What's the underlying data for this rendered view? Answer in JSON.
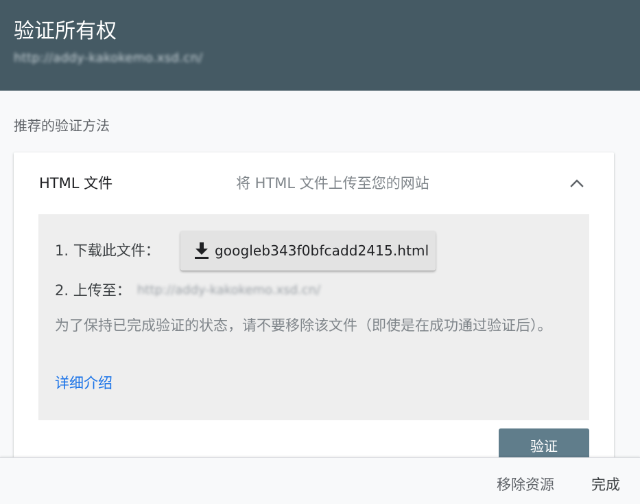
{
  "dialog": {
    "title": "验证所有权",
    "property_url": "http://addy-kakokemo.xsd.cn/"
  },
  "section": {
    "label": "推荐的验证方法"
  },
  "method_card": {
    "title": "HTML 文件",
    "subtitle": "将 HTML 文件上传至您的网站",
    "expanded": true,
    "step1_label": "1. 下载此文件：",
    "download_filename": "googleb343f0bfcadd2415.html",
    "step2_label": "2. 上传至：",
    "upload_url": "http://addy-kakokemo.xsd.cn/",
    "note": "为了保持已完成验证的状态，请不要移除该文件（即使是在成功通过验证后）。",
    "learn_more": "详细介绍",
    "verify_label": "验证"
  },
  "footer": {
    "remove_label": "移除资源",
    "done_label": "完成"
  },
  "colors": {
    "header_bg": "#455a64",
    "link": "#1a73e8",
    "verify_bg": "#607d8b"
  }
}
